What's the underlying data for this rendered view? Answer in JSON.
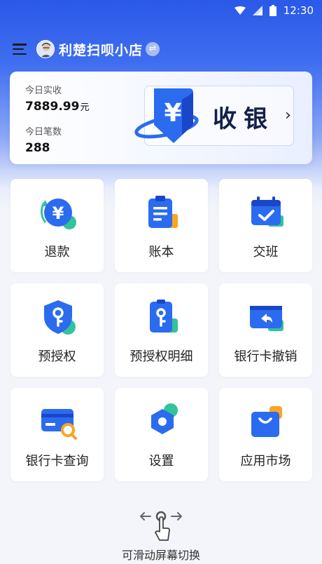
{
  "status_bar": {
    "time": "12:30",
    "icons": [
      "wifi-icon",
      "signal-icon",
      "battery-icon"
    ]
  },
  "header": {
    "store_name": "利楚扫呗小店",
    "menu_icon": "menu-icon",
    "switch_icon": "switch-icon"
  },
  "summary": {
    "today_income_label": "今日实收",
    "today_income_value": "7889.99",
    "today_income_unit": "元",
    "today_count_label": "今日笔数",
    "today_count_value": "288",
    "cashier_label": "收银"
  },
  "grid": [
    {
      "label": "退款",
      "icon": "refund-icon"
    },
    {
      "label": "账本",
      "icon": "ledger-icon"
    },
    {
      "label": "交班",
      "icon": "shift-handover-icon"
    },
    {
      "label": "预授权",
      "icon": "pre-auth-icon"
    },
    {
      "label": "预授权明细",
      "icon": "pre-auth-detail-icon"
    },
    {
      "label": "银行卡撤销",
      "icon": "card-revoke-icon"
    },
    {
      "label": "银行卡查询",
      "icon": "card-query-icon"
    },
    {
      "label": "设置",
      "icon": "settings-icon"
    },
    {
      "label": "应用市场",
      "icon": "app-market-icon"
    }
  ],
  "footer": {
    "swipe_hint": "可滑动屏幕切换"
  },
  "colors": {
    "brand_blue": "#2b6bf0",
    "accent_green": "#32c39a",
    "accent_orange": "#f7a623"
  }
}
